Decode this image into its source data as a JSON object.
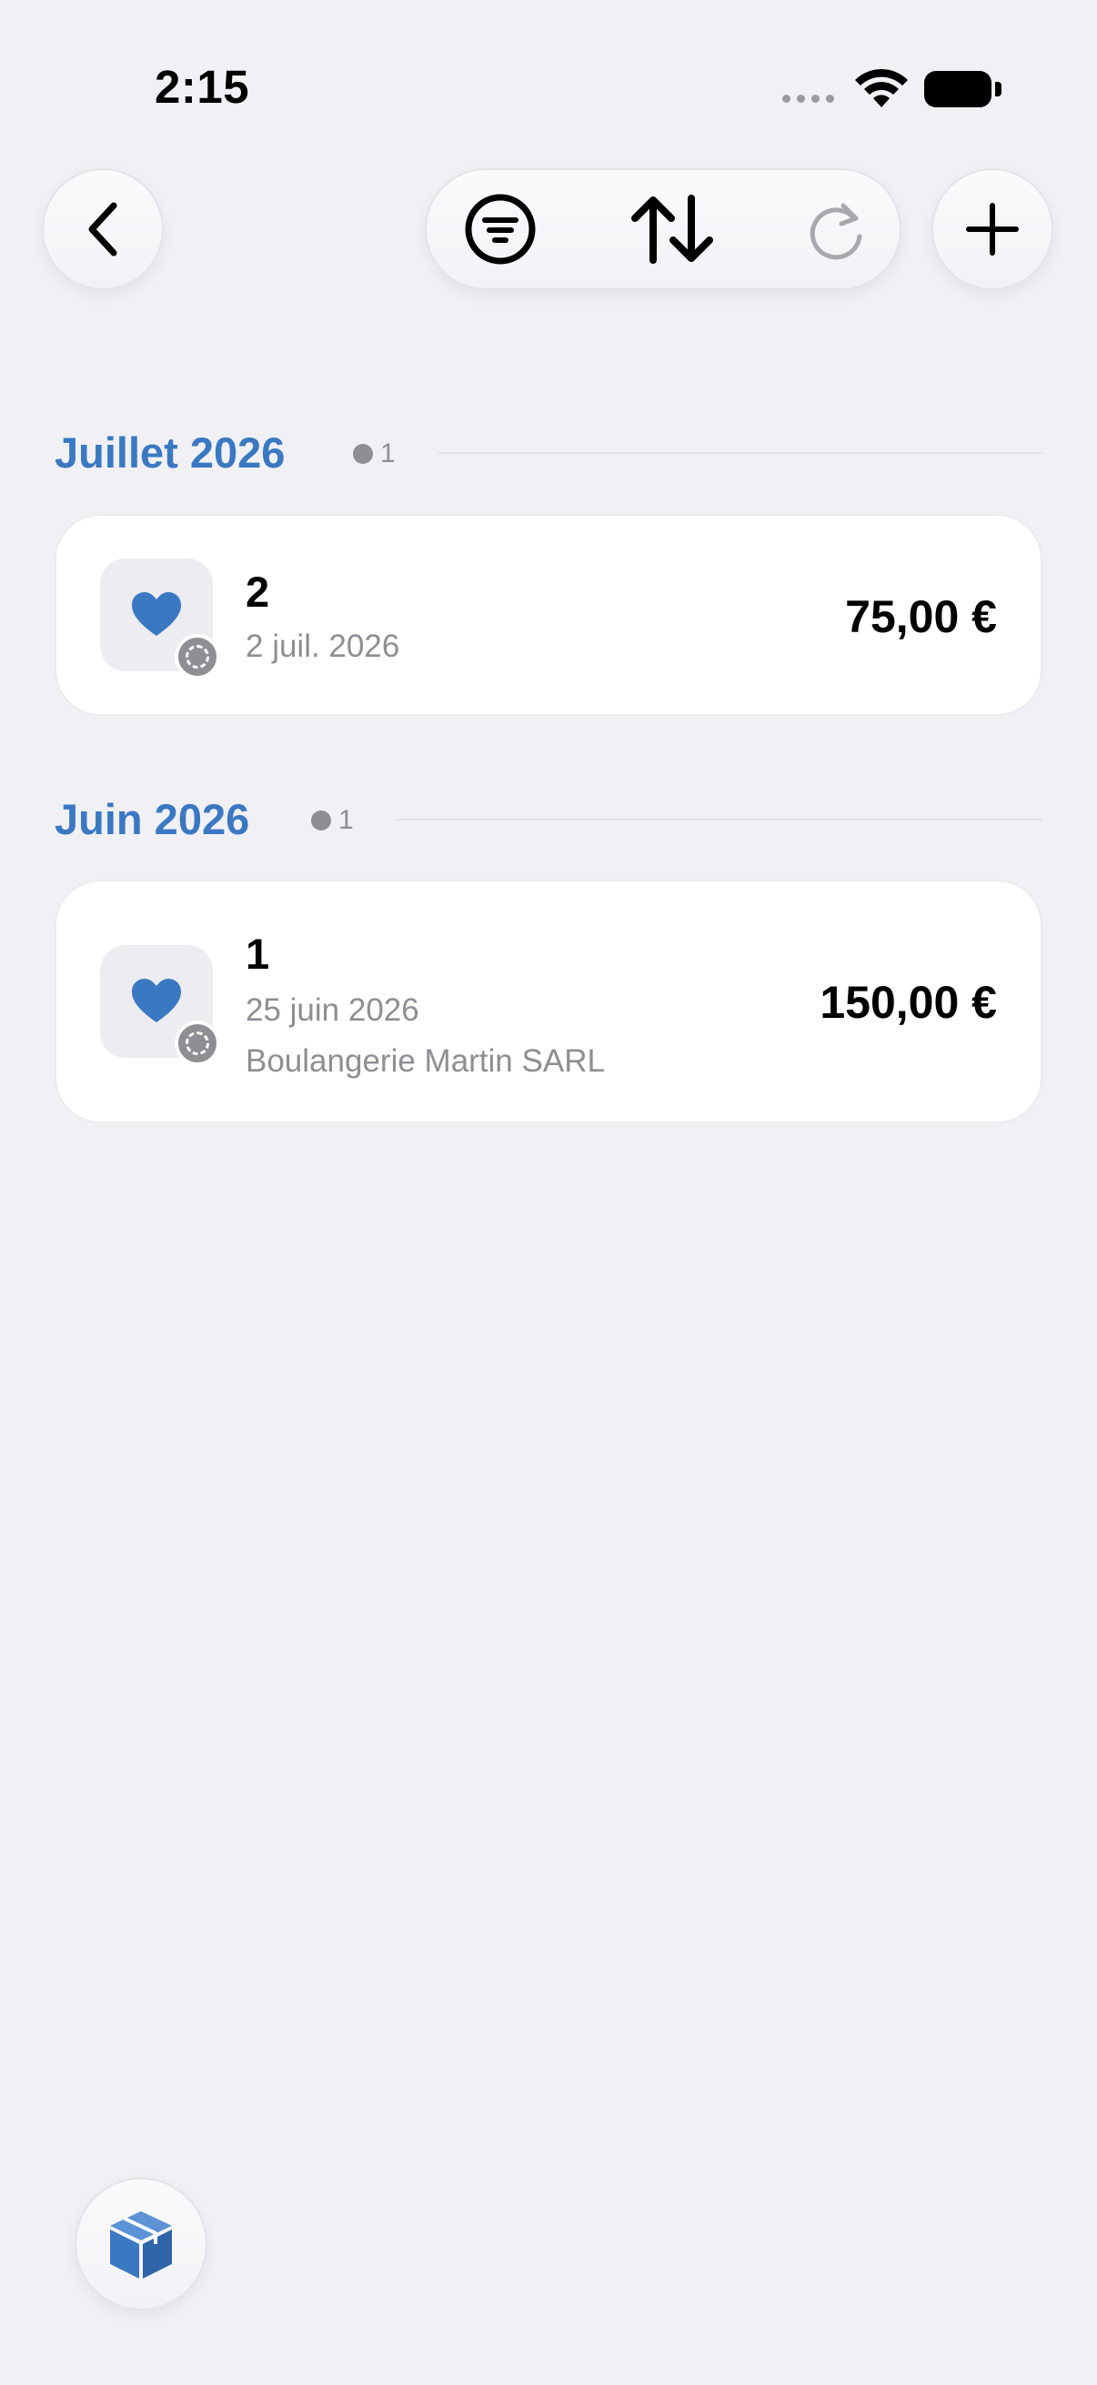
{
  "status_bar": {
    "time": "2:15"
  },
  "toolbar": {
    "back_icon": "chevron-left-icon",
    "filter_icon": "filter-circle-icon",
    "sort_icon": "sort-arrows-icon",
    "refresh_icon": "refresh-icon",
    "add_icon": "plus-icon"
  },
  "colors": {
    "accent": "#3a78c2",
    "background": "#f0f0f5",
    "secondary_text": "#8e8e93"
  },
  "sections": [
    {
      "title": "Juillet 2026",
      "count": "1",
      "items": [
        {
          "title": "2",
          "date": "2 juil. 2026",
          "merchant": "",
          "amount": "75,00 €",
          "icon": "heart-icon",
          "status_icon": "pending-status-icon"
        }
      ]
    },
    {
      "title": "Juin 2026",
      "count": "1",
      "items": [
        {
          "title": "1",
          "date": "25 juin 2026",
          "merchant": "Boulangerie Martin SARL",
          "amount": "150,00 €",
          "icon": "heart-icon",
          "status_icon": "pending-status-icon"
        }
      ]
    }
  ],
  "bottom_button": {
    "icon": "box-icon"
  }
}
